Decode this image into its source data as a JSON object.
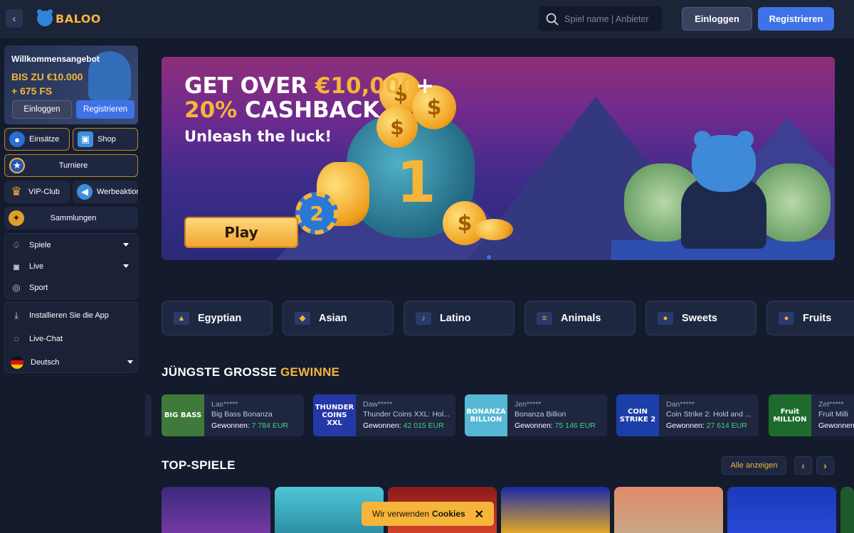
{
  "header": {
    "brand": "BALOO",
    "search_placeholder": "Spiel name | Anbieter",
    "login_label": "Einloggen",
    "register_label": "Registrieren"
  },
  "welcome": {
    "title": "Willkommensangebot",
    "amount_line1": "BIS ZU €10.000",
    "amount_line2": "+ 675 FS",
    "login_label": "Einloggen",
    "register_label": "Registrieren"
  },
  "sidebar": {
    "tiles": [
      {
        "label": "Einsätze",
        "icon": "bomb-icon"
      },
      {
        "label": "Shop",
        "icon": "chest-icon"
      },
      {
        "label": "Turniere",
        "icon": "trophy-shield-icon"
      },
      {
        "label": "VIP-Club",
        "icon": "crown-icon"
      },
      {
        "label": "Werbeaktionen",
        "icon": "megaphone-icon"
      },
      {
        "label": "Sammlungen",
        "icon": "medal-icon"
      }
    ],
    "nav": [
      {
        "label": "Spiele",
        "icon": "spade-icon"
      },
      {
        "label": "Live",
        "icon": "live-icon"
      },
      {
        "label": "Sport",
        "icon": "soccer-ball-icon"
      }
    ],
    "extra": [
      {
        "label": "Installieren Sie die App",
        "icon": "download-icon"
      },
      {
        "label": "Live-Chat",
        "icon": "chat-icon"
      },
      {
        "label": "Deutsch",
        "icon": "germany-flag-icon"
      }
    ]
  },
  "banner": {
    "line1_prefix": "GET OVER ",
    "line1_amount": "€10,000",
    "line1_suffix": "+",
    "line2_amount": "20%",
    "line2_suffix": " CASHBACK",
    "subtitle": "Unleash the luck!",
    "play_label": "Play",
    "coin_symbol": "$",
    "bag_number": "1",
    "chip_number": "2"
  },
  "categories": [
    {
      "label": "Egyptian"
    },
    {
      "label": "Asian"
    },
    {
      "label": "Latino"
    },
    {
      "label": "Animals"
    },
    {
      "label": "Sweets"
    },
    {
      "label": "Fruits"
    }
  ],
  "recent_wins": {
    "title_main": "JÜNGSTE GROSSE ",
    "title_accent": "GEWINNE",
    "won_label": "Gewonnen:",
    "items": [
      {
        "user": "Las*****",
        "game": "Big Bass Bonanza",
        "amount": "7 784 EUR",
        "thumb": "BIG BASS",
        "color": "#3f7a3a"
      },
      {
        "user": "Daw*****",
        "game": "Thunder Coins XXL: Hol...",
        "amount": "42 015 EUR",
        "thumb": "THUNDER COINS XXL",
        "color": "#2438a8"
      },
      {
        "user": "Jen*****",
        "game": "Bonanza Billion",
        "amount": "75 146 EUR",
        "thumb": "BONANZA BILLION",
        "color": "#56b8d4"
      },
      {
        "user": "Dan*****",
        "game": "Coin Strike 2: Hold and ...",
        "amount": "27 614 EUR",
        "thumb": "COIN STRIKE 2",
        "color": "#1b3ea8"
      },
      {
        "user": "Zet*****",
        "game": "Fruit Milli",
        "amount": "",
        "thumb": "Fruit MILLION",
        "color": "#1f6b2e"
      }
    ]
  },
  "top_games": {
    "title": "TOP-SPIELE",
    "show_all_label": "Alle anzeigen",
    "prev_symbol": "‹",
    "next_symbol": "›"
  },
  "cookie": {
    "text": "Wir verwenden",
    "bold": "Cookies",
    "close": "✕"
  },
  "colors": {
    "accent_gold": "#f4b53a",
    "accent_blue": "#3e72e6",
    "win_green": "#43d17a"
  }
}
